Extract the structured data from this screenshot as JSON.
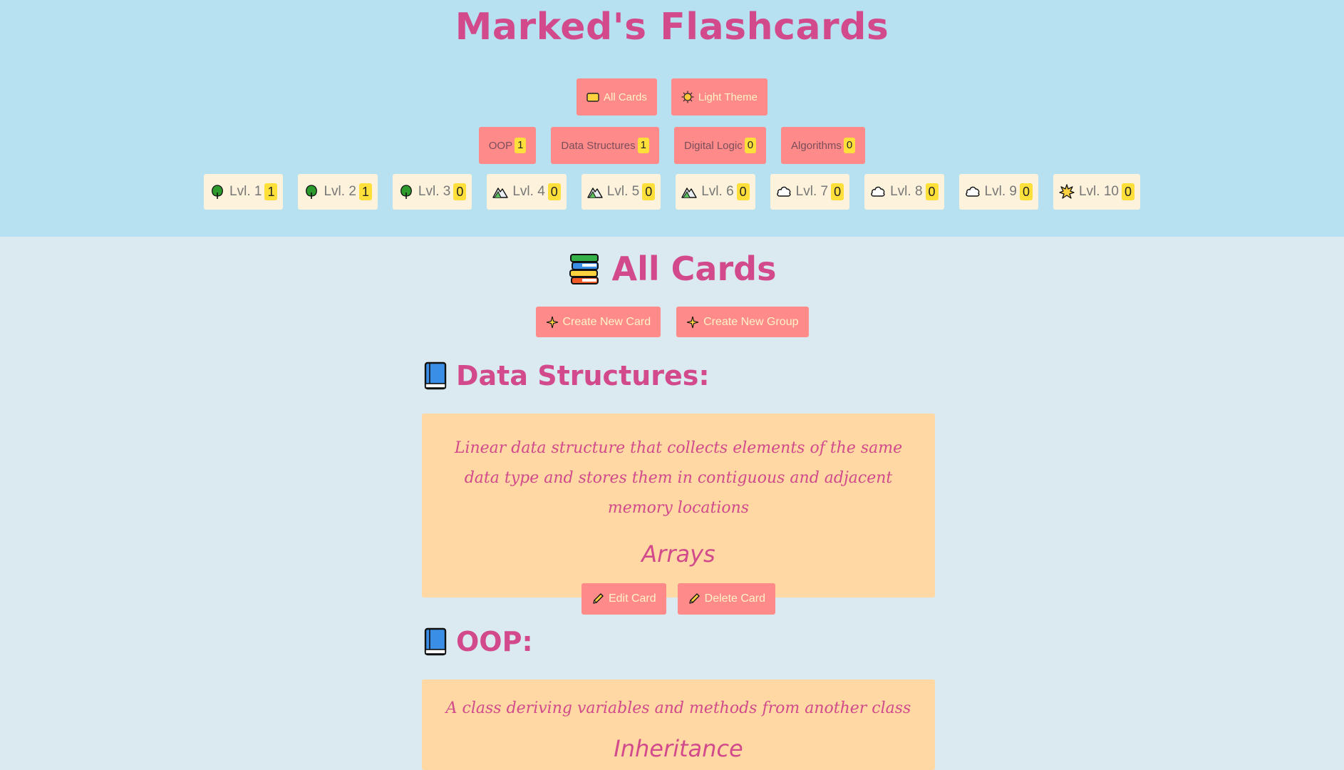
{
  "app": {
    "title": "Marked's Flashcards"
  },
  "nav": {
    "all_cards": "All Cards",
    "theme": "Light Theme"
  },
  "groups": [
    {
      "label": "OOP",
      "count": "1"
    },
    {
      "label": "Data Structures",
      "count": "1"
    },
    {
      "label": "Digital Logic",
      "count": "0"
    },
    {
      "label": "Algorithms",
      "count": "0"
    }
  ],
  "levels": [
    {
      "label": "Lvl. 1",
      "count": "1",
      "icon": "tree-icon"
    },
    {
      "label": "Lvl. 2",
      "count": "1",
      "icon": "tree-icon"
    },
    {
      "label": "Lvl. 3",
      "count": "0",
      "icon": "tree-icon"
    },
    {
      "label": "Lvl. 4",
      "count": "0",
      "icon": "mountain-icon"
    },
    {
      "label": "Lvl. 5",
      "count": "0",
      "icon": "mountain-icon"
    },
    {
      "label": "Lvl. 6",
      "count": "0",
      "icon": "mountain-icon"
    },
    {
      "label": "Lvl. 7",
      "count": "0",
      "icon": "cloud-icon"
    },
    {
      "label": "Lvl. 8",
      "count": "0",
      "icon": "cloud-icon"
    },
    {
      "label": "Lvl. 9",
      "count": "0",
      "icon": "cloud-icon"
    },
    {
      "label": "Lvl. 10",
      "count": "0",
      "icon": "star-burst-icon"
    }
  ],
  "main": {
    "title": "All Cards",
    "create_card": "Create New Card",
    "create_group": "Create New Group"
  },
  "sections": [
    {
      "heading": "Data Structures:",
      "cards": [
        {
          "definition": "Linear data structure that collects elements of the same data type and stores them in contiguous and adjacent memory locations",
          "term": "Arrays",
          "edit": "Edit Card",
          "delete": "Delete Card"
        }
      ]
    },
    {
      "heading": "OOP:",
      "cards": [
        {
          "definition": "A class deriving variables and methods from another class",
          "term": "Inheritance"
        }
      ]
    }
  ],
  "colors": {
    "header_bg": "#b7e1f0",
    "page_bg": "#dbeaf0",
    "accent_pink": "#d24a8c",
    "button_salmon": "#ff8a8a",
    "badge_yellow": "#ffe03a",
    "card_bg": "#ffd8a3"
  }
}
